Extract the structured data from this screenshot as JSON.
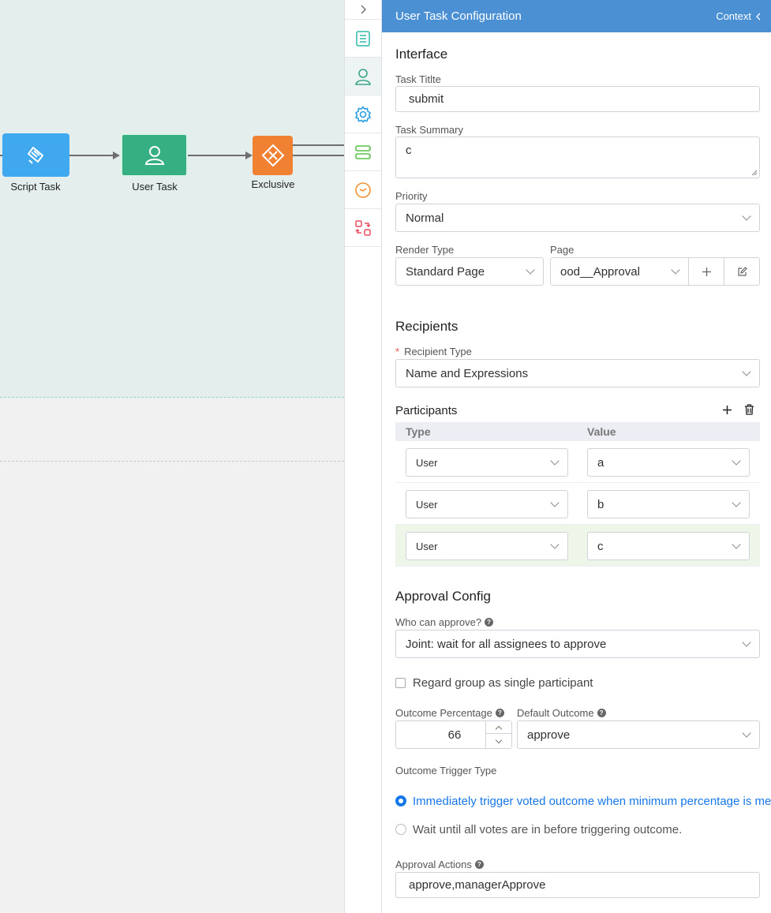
{
  "canvas": {
    "nodes": {
      "script_task": {
        "label": "Script Task",
        "color": "#40a8ee"
      },
      "user_task": {
        "label": "User Task",
        "color": "#36b083"
      },
      "exclusive": {
        "label": "Exclusive",
        "color": "#f08032"
      }
    }
  },
  "rail": {
    "toggle_icon": "chevron-right-icon",
    "items": [
      {
        "name": "properties",
        "icon": "list-icon",
        "color": "#2fbaa8"
      },
      {
        "name": "user",
        "icon": "user-icon",
        "color": "#3aa58a"
      },
      {
        "name": "settings",
        "icon": "gear-icon",
        "color": "#2a9ee0"
      },
      {
        "name": "data",
        "icon": "server-icon",
        "color": "#5ac24a"
      },
      {
        "name": "timer",
        "icon": "clock-icon",
        "color": "#f09030"
      },
      {
        "name": "mapping",
        "icon": "swap-icon",
        "color": "#ee4d5f"
      }
    ]
  },
  "panel": {
    "title": "User Task Configuration",
    "context_label": "Context",
    "interface": {
      "heading": "Interface",
      "task_title_label": "Task Titlte",
      "task_title_value": "submit",
      "task_summary_label": "Task Summary",
      "task_summary_value": "c",
      "priority_label": "Priority",
      "priority_value": "Normal",
      "render_type_label": "Render Type",
      "render_type_value": "Standard Page",
      "page_label": "Page",
      "page_value": "ood__Approval"
    },
    "recipients": {
      "heading": "Recipients",
      "type_label": "Recipient Type",
      "type_value": "Name and Expressions",
      "participants_label": "Participants",
      "columns": {
        "type": "Type",
        "value": "Value"
      },
      "rows": [
        {
          "type": "User",
          "value": "a"
        },
        {
          "type": "User",
          "value": "b"
        },
        {
          "type": "User",
          "value": "c"
        }
      ]
    },
    "approval": {
      "heading": "Approval Config",
      "who_label": "Who can approve?",
      "who_value": "Joint: wait for all assignees to approve",
      "group_checkbox_label": "Regard group as single participant",
      "outcome_pct_label": "Outcome Percentage",
      "outcome_pct_value": "66",
      "default_outcome_label": "Default Outcome",
      "default_outcome_value": "approve",
      "trigger_label": "Outcome Trigger Type",
      "trigger_options": [
        {
          "label": "Immediately trigger voted outcome when minimum percentage is met",
          "selected": true
        },
        {
          "label": "Wait until all votes are in before triggering outcome.",
          "selected": false
        }
      ],
      "actions_label": "Approval Actions",
      "actions_value": "approve,managerApprove"
    }
  }
}
